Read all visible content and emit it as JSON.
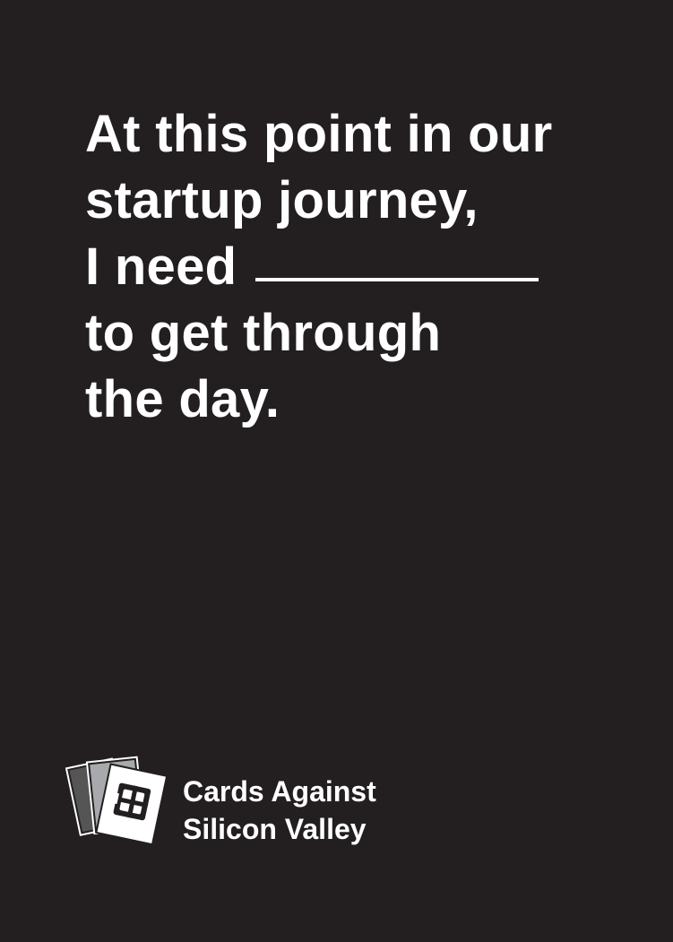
{
  "card": {
    "prompt_lines": [
      "At this point in our",
      "startup journey,",
      "I need",
      "to get through",
      "the day."
    ],
    "blank": "__________"
  },
  "brand": {
    "line1": "Cards Against",
    "line2": "Silicon Valley",
    "logo_icon": "stacked-cards-logo-icon"
  },
  "colors": {
    "background": "#231f20",
    "text": "#ffffff",
    "logo_back_card": "#555555",
    "logo_middle_card": "#a7a9ac",
    "logo_front_card": "#ffffff"
  }
}
